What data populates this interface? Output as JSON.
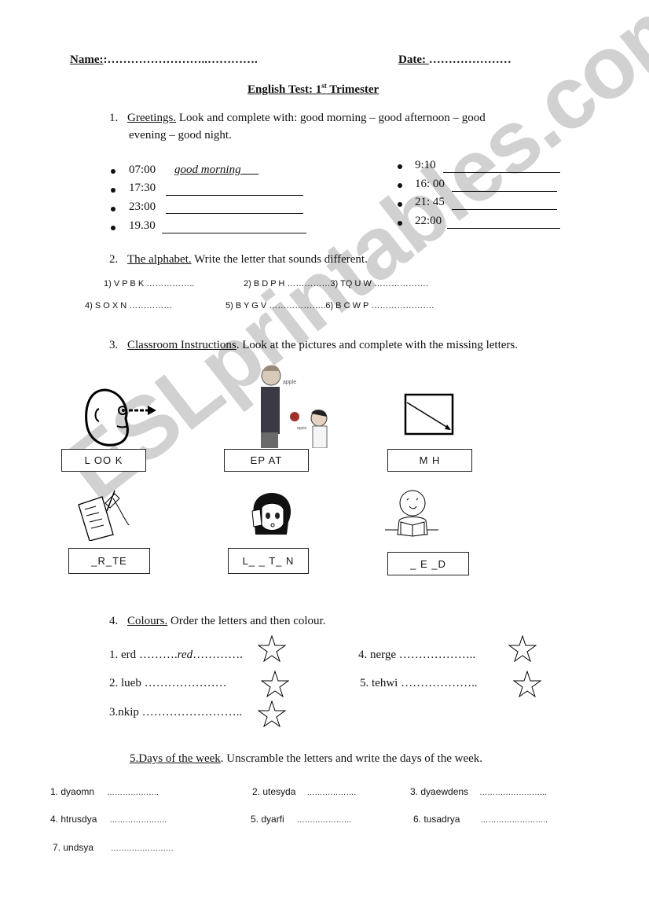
{
  "header": {
    "name_label": "Name:",
    "name_dots": ":……………………..………….",
    "date_label": "Date: ",
    "date_dots": "…………………",
    "title_main": "English Test: 1",
    "title_sup": "st",
    "title_end": " Trimester"
  },
  "section1": {
    "number": "1.",
    "heading": "Greetings.",
    "instruction": " Look and complete with:      good morning – good afternoon – good",
    "instruction_line2": "evening – good night.",
    "left_items": [
      {
        "time": "07:00",
        "answer": "good morning"
      },
      {
        "time": "17:30",
        "answer": ""
      },
      {
        "time": "23:00",
        "answer": ""
      },
      {
        "time": "19.30",
        "answer": ""
      }
    ],
    "right_items": [
      {
        "time": "9:10",
        "answer": ""
      },
      {
        "time": "16: 00",
        "answer": ""
      },
      {
        "time": "21: 45",
        "answer": ""
      },
      {
        "time": "22:00",
        "answer": ""
      }
    ]
  },
  "section2": {
    "number": "2.",
    "heading": "The alphabet.",
    "instruction": " Write the letter that sounds different.",
    "row1": [
      "1)    V P B K ……………..",
      "2)  B D P H ……………3)   TQ U W ………………."
    ],
    "row2": [
      "4)   S O X N ……………",
      "5)   B Y G V  ………………..6) B C W P …………………."
    ]
  },
  "section3": {
    "number": "3.",
    "heading": "Classroom Instructions",
    "instruction": ". Look at the pictures and complete with the missing letters.",
    "cards": [
      {
        "picture": "look-face",
        "word": "L OO K"
      },
      {
        "picture": "repeat-teacher",
        "word": "EP  AT"
      },
      {
        "picture": "match-box",
        "word": "M          H"
      },
      {
        "picture": "write-hand",
        "word": "_R_TE"
      },
      {
        "picture": "listen-girl",
        "word": "L_ _ T_ N"
      },
      {
        "picture": "read-boy",
        "word": "_ E _D"
      }
    ]
  },
  "section4": {
    "number": "4.",
    "heading": "Colours.",
    "instruction": "  Order the letters and then colour.",
    "items": [
      {
        "label": "1.   erd",
        "dots_before": "  ……….",
        "answer": "red",
        "dots_after": "…………."
      },
      {
        "label": "2. lueb",
        "dots_before": "   …………………",
        "answer": "",
        "dots_after": ""
      },
      {
        "label": "3.nkip",
        "dots_before": " ……………………..",
        "answer": "",
        "dots_after": ""
      },
      {
        "label": "4. nerge",
        "dots_before": " ………………..",
        "answer": "",
        "dots_after": ""
      },
      {
        "label": "5. tehwi",
        "dots_before": " ………………..",
        "answer": "",
        "dots_after": ""
      }
    ]
  },
  "section5": {
    "heading": "5.Days of the week",
    "instruction": ".  Unscramble the letters and write the days of the week.",
    "items": [
      {
        "label": "1.    dyaomn",
        "dots": "……………….."
      },
      {
        "label": "2. utesyda",
        "dots": "………………."
      },
      {
        "label": "3.   dyaewdens",
        "dots": "…………………….."
      },
      {
        "label": "4.  htrusdya",
        "dots": "…………………."
      },
      {
        "label": "5. dyarfi",
        "dots": "…………………"
      },
      {
        "label": "6. tusadrya",
        "dots": "…………………….."
      },
      {
        "label": "7. undsya",
        "dots": "……………………"
      }
    ]
  },
  "watermark": "ESLprintables.com"
}
